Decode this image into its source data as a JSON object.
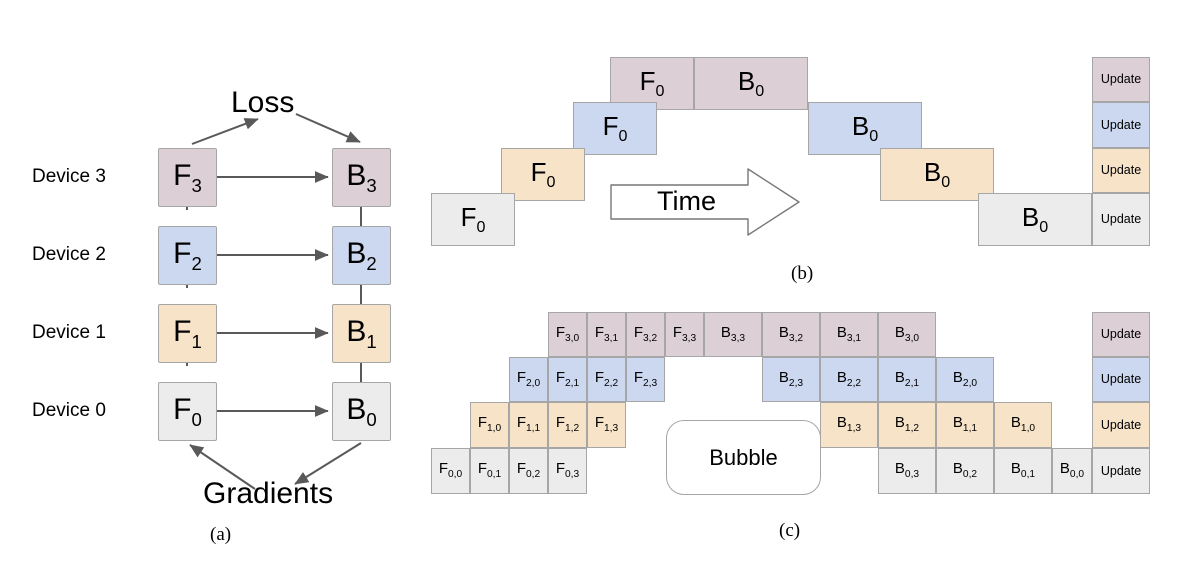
{
  "figure": {
    "panel_a": {
      "caption": "(a)",
      "top_label": "Loss",
      "bottom_label": "Gradients",
      "device_labels": [
        "Device 3",
        "Device 2",
        "Device 1",
        "Device 0"
      ],
      "forward_boxes": [
        {
          "letter": "F",
          "sub": "3",
          "device": 3
        },
        {
          "letter": "F",
          "sub": "2",
          "device": 2
        },
        {
          "letter": "F",
          "sub": "1",
          "device": 1
        },
        {
          "letter": "F",
          "sub": "0",
          "device": 0
        }
      ],
      "backward_boxes": [
        {
          "letter": "B",
          "sub": "3",
          "device": 3
        },
        {
          "letter": "B",
          "sub": "2",
          "device": 2
        },
        {
          "letter": "B",
          "sub": "1",
          "device": 1
        },
        {
          "letter": "B",
          "sub": "0",
          "device": 0
        }
      ]
    },
    "panel_b": {
      "caption": "(b)",
      "time_label": "Time",
      "update_label": "Update",
      "rows": [
        {
          "device": 3,
          "forward": {
            "letter": "F",
            "sub": "0"
          },
          "backward": {
            "letter": "B",
            "sub": "0"
          }
        },
        {
          "device": 2,
          "forward": {
            "letter": "F",
            "sub": "0"
          },
          "backward": {
            "letter": "B",
            "sub": "0"
          }
        },
        {
          "device": 1,
          "forward": {
            "letter": "F",
            "sub": "0"
          },
          "backward": {
            "letter": "B",
            "sub": "0"
          }
        },
        {
          "device": 0,
          "forward": {
            "letter": "F",
            "sub": "0"
          },
          "backward": {
            "letter": "B",
            "sub": "0"
          }
        }
      ]
    },
    "panel_c": {
      "caption": "(c)",
      "bubble_label": "Bubble",
      "update_label": "Update",
      "rows": [
        {
          "device": 3,
          "forward": [
            {
              "letter": "F",
              "sub": "3,0"
            },
            {
              "letter": "F",
              "sub": "3,1"
            },
            {
              "letter": "F",
              "sub": "3,2"
            },
            {
              "letter": "F",
              "sub": "3,3"
            }
          ],
          "backward": [
            {
              "letter": "B",
              "sub": "3,3"
            },
            {
              "letter": "B",
              "sub": "3,2"
            },
            {
              "letter": "B",
              "sub": "3,1"
            },
            {
              "letter": "B",
              "sub": "3,0"
            }
          ]
        },
        {
          "device": 2,
          "forward": [
            {
              "letter": "F",
              "sub": "2,0"
            },
            {
              "letter": "F",
              "sub": "2,1"
            },
            {
              "letter": "F",
              "sub": "2,2"
            },
            {
              "letter": "F",
              "sub": "2,3"
            }
          ],
          "backward": [
            {
              "letter": "B",
              "sub": "2,3"
            },
            {
              "letter": "B",
              "sub": "2,2"
            },
            {
              "letter": "B",
              "sub": "2,1"
            },
            {
              "letter": "B",
              "sub": "2,0"
            }
          ]
        },
        {
          "device": 1,
          "forward": [
            {
              "letter": "F",
              "sub": "1,0"
            },
            {
              "letter": "F",
              "sub": "1,1"
            },
            {
              "letter": "F",
              "sub": "1,2"
            },
            {
              "letter": "F",
              "sub": "1,3"
            }
          ],
          "backward": [
            {
              "letter": "B",
              "sub": "1,3"
            },
            {
              "letter": "B",
              "sub": "1,2"
            },
            {
              "letter": "B",
              "sub": "1,1"
            },
            {
              "letter": "B",
              "sub": "1,0"
            }
          ]
        },
        {
          "device": 0,
          "forward": [
            {
              "letter": "F",
              "sub": "0,0"
            },
            {
              "letter": "F",
              "sub": "0,1"
            },
            {
              "letter": "F",
              "sub": "0,2"
            },
            {
              "letter": "F",
              "sub": "0,3"
            }
          ],
          "backward": [
            {
              "letter": "B",
              "sub": "0,3"
            },
            {
              "letter": "B",
              "sub": "0,2"
            },
            {
              "letter": "B",
              "sub": "0,1"
            },
            {
              "letter": "B",
              "sub": "0,0"
            }
          ]
        }
      ]
    }
  },
  "colors": {
    "device0": "#ececec",
    "device1": "#f7e3c8",
    "device2": "#ccd7f0",
    "device3": "#ddcfd6",
    "stroke": "#a6a6a6",
    "arrow": "#595959"
  }
}
